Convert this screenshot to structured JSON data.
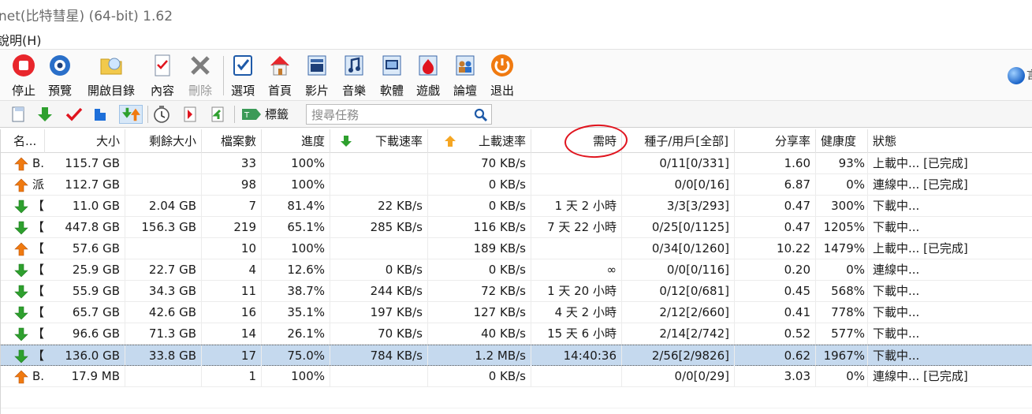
{
  "window": {
    "title": "net(比特彗星) (64-bit) 1.62"
  },
  "menu": {
    "visible_item": "說明(H)"
  },
  "toolbar": {
    "buttons": [
      {
        "label": "停止",
        "icon": "stop-icon",
        "disabled": false
      },
      {
        "label": "預覽",
        "icon": "preview-icon",
        "disabled": false
      },
      {
        "label": "開啟目錄",
        "icon": "open-folder-icon",
        "disabled": false
      },
      {
        "label": "內容",
        "icon": "properties-icon",
        "disabled": false
      },
      {
        "label": "刪除",
        "icon": "delete-icon",
        "disabled": true
      },
      {
        "label": "選項",
        "icon": "options-icon",
        "disabled": false
      },
      {
        "label": "首頁",
        "icon": "home-icon",
        "disabled": false
      },
      {
        "label": "影片",
        "icon": "video-icon",
        "disabled": false
      },
      {
        "label": "音樂",
        "icon": "music-icon",
        "disabled": false
      },
      {
        "label": "軟體",
        "icon": "software-icon",
        "disabled": false
      },
      {
        "label": "遊戲",
        "icon": "games-icon",
        "disabled": false
      },
      {
        "label": "論壇",
        "icon": "forum-icon",
        "disabled": false
      },
      {
        "label": "退出",
        "icon": "exit-icon",
        "disabled": false
      }
    ],
    "partial_right_text": "言"
  },
  "filterbar": {
    "tag_label": "標籤",
    "search_placeholder": "搜尋任務"
  },
  "table": {
    "headers": {
      "name": "名...",
      "size": "大小",
      "remaining": "剩餘大小",
      "files": "檔案數",
      "progress": "進度",
      "down_speed": "下載速率",
      "up_speed": "上載速率",
      "eta": "需時",
      "seeds": "種子/用戶[全部]",
      "ratio": "分享率",
      "health": "健康度",
      "status": "狀態"
    },
    "rows": [
      {
        "dir": "up",
        "name": "B.",
        "size": "115.7 GB",
        "remaining": "",
        "files": "33",
        "progress": "100%",
        "down": "",
        "up": "70 KB/s",
        "eta": "",
        "seeds": "0/11[0/331]",
        "ratio": "1.60",
        "health": "93%",
        "status": "上載中... [已完成]"
      },
      {
        "dir": "up",
        "name": "派",
        "size": "112.7 GB",
        "remaining": "",
        "files": "98",
        "progress": "100%",
        "down": "",
        "up": "0 KB/s",
        "eta": "",
        "seeds": "0/0[0/16]",
        "ratio": "6.87",
        "health": "0%",
        "status": "連線中... [已完成]"
      },
      {
        "dir": "down",
        "name": "【",
        "size": "11.0 GB",
        "remaining": "2.04 GB",
        "files": "7",
        "progress": "81.4%",
        "down": "22 KB/s",
        "up": "0 KB/s",
        "eta": "1 天 2 小時",
        "seeds": "3/3[3/293]",
        "ratio": "0.47",
        "health": "300%",
        "status": "下載中..."
      },
      {
        "dir": "down",
        "name": "【",
        "size": "447.8 GB",
        "remaining": "156.3 GB",
        "files": "219",
        "progress": "65.1%",
        "down": "285 KB/s",
        "up": "116 KB/s",
        "eta": "7 天 22 小時",
        "seeds": "0/25[0/1125]",
        "ratio": "0.47",
        "health": "1205%",
        "status": "下載中..."
      },
      {
        "dir": "up",
        "name": "【",
        "size": "57.6 GB",
        "remaining": "",
        "files": "10",
        "progress": "100%",
        "down": "",
        "up": "189 KB/s",
        "eta": "",
        "seeds": "0/34[0/1260]",
        "ratio": "10.22",
        "health": "1479%",
        "status": "上載中... [已完成]"
      },
      {
        "dir": "down",
        "name": "【",
        "size": "25.9 GB",
        "remaining": "22.7 GB",
        "files": "4",
        "progress": "12.6%",
        "down": "0 KB/s",
        "up": "0 KB/s",
        "eta": "∞",
        "seeds": "0/0[0/116]",
        "ratio": "0.20",
        "health": "0%",
        "status": "連線中..."
      },
      {
        "dir": "down",
        "name": "【",
        "size": "55.9 GB",
        "remaining": "34.3 GB",
        "files": "11",
        "progress": "38.7%",
        "down": "244 KB/s",
        "up": "72 KB/s",
        "eta": "1 天 20 小時",
        "seeds": "0/12[0/681]",
        "ratio": "0.45",
        "health": "568%",
        "status": "下載中..."
      },
      {
        "dir": "down",
        "name": "【",
        "size": "65.7 GB",
        "remaining": "42.6 GB",
        "files": "16",
        "progress": "35.1%",
        "down": "197 KB/s",
        "up": "127 KB/s",
        "eta": "4 天 2 小時",
        "seeds": "2/12[2/660]",
        "ratio": "0.41",
        "health": "778%",
        "status": "下載中..."
      },
      {
        "dir": "down",
        "name": "【",
        "size": "96.6 GB",
        "remaining": "71.3 GB",
        "files": "14",
        "progress": "26.1%",
        "down": "70 KB/s",
        "up": "40 KB/s",
        "eta": "15 天 6 小時",
        "seeds": "2/14[2/742]",
        "ratio": "0.52",
        "health": "577%",
        "status": "下載中..."
      },
      {
        "dir": "down",
        "name": "【",
        "size": "136.0 GB",
        "remaining": "33.8 GB",
        "files": "17",
        "progress": "75.0%",
        "down": "784 KB/s",
        "up": "1.2 MB/s",
        "eta": "14:40:36",
        "seeds": "2/56[2/9826]",
        "ratio": "0.62",
        "health": "1967%",
        "status": "下載中...",
        "selected": true
      },
      {
        "dir": "up",
        "name": "B.",
        "size": "17.9 MB",
        "remaining": "",
        "files": "1",
        "progress": "100%",
        "down": "",
        "up": "0 KB/s",
        "eta": "",
        "seeds": "0/0[0/29]",
        "ratio": "3.03",
        "health": "0%",
        "status": "連線中... [已完成]"
      }
    ]
  },
  "colors": {
    "selected_row": "#c5d9ee",
    "download_arrow": "#2ea02e",
    "upload_arrow": "#f07a10",
    "annotation": "#e0141e"
  }
}
